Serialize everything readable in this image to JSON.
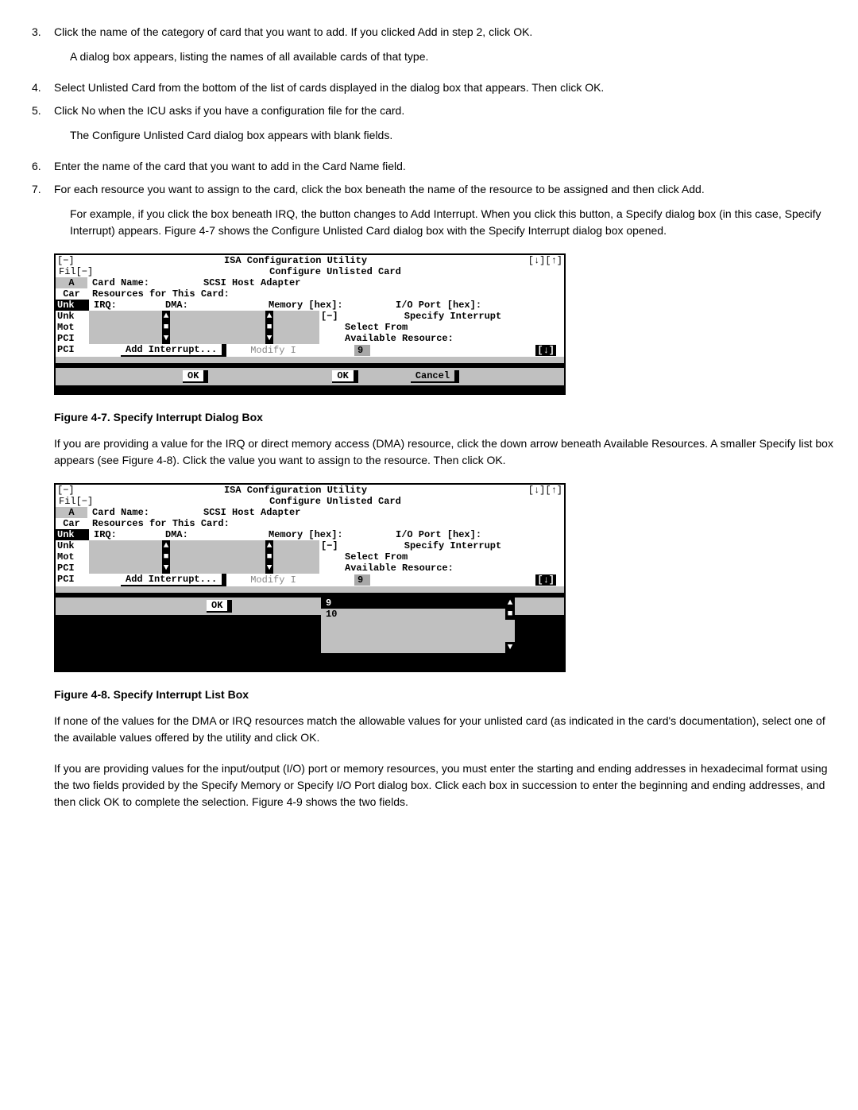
{
  "steps": [
    {
      "n": "3.",
      "text": "Click the name of the category of card that you want to add. If you clicked Add in step 2, click OK.",
      "after": "A dialog box appears, listing the names of all available cards of that type."
    },
    {
      "n": "4.",
      "text": "Select Unlisted Card from the bottom of the list of cards displayed in the dialog box that appears. Then click OK."
    },
    {
      "n": "5.",
      "text": "Click No when the ICU asks if you have a configuration file for the card.",
      "after": "The Configure Unlisted Card dialog box appears with blank fields."
    },
    {
      "n": "6.",
      "text": "Enter the name of the card that you want to add in the Card Name field."
    },
    {
      "n": "7.",
      "text": "For each resource you want to assign to the card, click the box beneath the name of the resource to be assigned and then click Add.",
      "after": "For example, if you click the box beneath IRQ, the button changes to Add Interrupt. When you click this button, a Specify dialog box (in this case, Specify Interrupt) appears. Figure 4-7 shows the Configure Unlisted Card dialog box with the Specify Interrupt dialog box opened."
    }
  ],
  "fig47": {
    "caption": "Figure 4-7. Specify Interrupt Dialog Box",
    "title_left": "[−]",
    "title_center": "ISA Configuration Utility",
    "title_right": "[↓][↑]",
    "menu_left": "Fil[−]",
    "subtitle": "Configure Unlisted Card",
    "side_a": "A",
    "card_name_label": "Card Name:",
    "card_name_value": "SCSI Host Adapter",
    "side_car": "Car",
    "resources_label": "Resources for This Card:",
    "cols": {
      "irq": "IRQ:",
      "dma": "DMA:",
      "mem": "Memory [hex]:",
      "io": "I/O Port [hex]:"
    },
    "side_list": [
      "Unk",
      "Unk",
      "Mot",
      "PCI",
      "PCI"
    ],
    "specify_corner": "[−]",
    "specify_title": "Specify Interrupt",
    "specify_line1": "Select From",
    "specify_line2": "Available Resource:",
    "specify_value": "9",
    "specify_scroll": "[↓]",
    "add_interrupt": "Add Interrupt...",
    "modify": "Modify I",
    "ok": "OK",
    "cancel": "Cancel"
  },
  "para_after_47": "If you are providing a value for the IRQ or direct memory access (DMA) resource, click the down arrow beneath Available Resources. A smaller Specify list box appears (see Figure 4-8). Click the value you want to assign to the resource. Then click OK.",
  "fig48": {
    "caption": "Figure 4-8. Specify Interrupt List Box",
    "title_left": "[−]",
    "title_center": "ISA Configuration Utility",
    "title_right": "[↓][↑]",
    "menu_left": "Fil[−]",
    "subtitle": "Configure Unlisted Card",
    "side_a": "A",
    "card_name_label": "Card Name:",
    "card_name_value": "SCSI Host Adapter",
    "side_car": "Car",
    "resources_label": "Resources for This Card:",
    "cols": {
      "irq": "IRQ:",
      "dma": "DMA:",
      "mem": "Memory [hex]:",
      "io": "I/O Port [hex]:"
    },
    "side_list": [
      "Unk",
      "Unk",
      "Mot",
      "PCI",
      "PCI"
    ],
    "specify_corner": "[−]",
    "specify_title": "Specify Interrupt",
    "specify_line1": "Select From",
    "specify_line2": "Available Resource:",
    "specify_value": "9",
    "specify_scroll": "[↓]",
    "add_interrupt": "Add Interrupt...",
    "modify": "Modify I",
    "ok": "OK",
    "dropdown": [
      "9",
      "10"
    ],
    "dropdown_scroll_top": "▲",
    "dropdown_scroll_bottom": "▼"
  },
  "para_after_48a": "If none of the values for the DMA or IRQ resources match the allowable values for your unlisted card (as indicated in the card's documentation), select one of the available values offered by the utility and click OK.",
  "para_after_48b": "If you are providing values for the input/output (I/O) port or memory resources, you must enter the starting and ending addresses in hexadecimal format using the two fields provided by the Specify Memory or Specify I/O Port dialog box. Click each box in succession to enter the beginning and ending addresses, and then click OK to complete the selection. Figure 4-9 shows the two fields."
}
